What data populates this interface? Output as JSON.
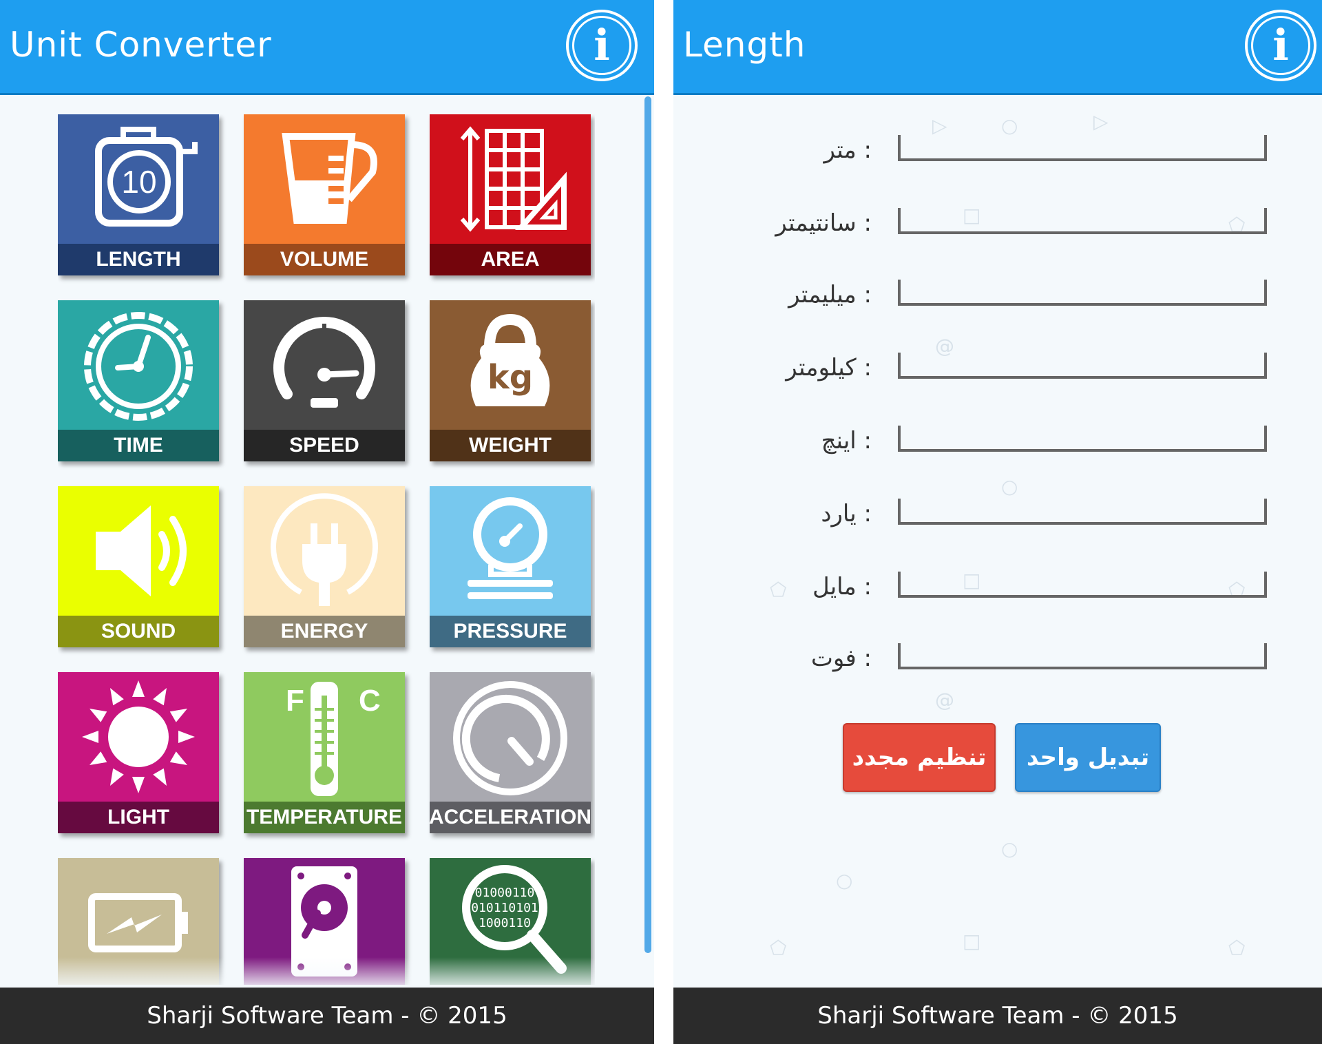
{
  "left_screen": {
    "title": "Unit Converter",
    "info_glyph": "i",
    "tiles": [
      {
        "label": "LENGTH",
        "bg": "#3c5fa3",
        "band": "#1f3a6b",
        "icon": "tape-measure-icon",
        "number": "10"
      },
      {
        "label": "VOLUME",
        "bg": "#f47a2e",
        "band": "#9b4a1c",
        "icon": "measuring-cup-icon"
      },
      {
        "label": "AREA",
        "bg": "#d0101b",
        "band": "#74050c",
        "icon": "grid-ruler-icon"
      },
      {
        "label": "TIME",
        "bg": "#2aa7a4",
        "band": "#17605e",
        "icon": "clock-icon"
      },
      {
        "label": "SPEED",
        "bg": "#474747",
        "band": "#262626",
        "icon": "speedometer-icon"
      },
      {
        "label": "WEIGHT",
        "bg": "#8a5b33",
        "band": "#503218",
        "icon": "kettlebell-icon",
        "weight_text": "kg"
      },
      {
        "label": "SOUND",
        "bg": "#eaff00",
        "band": "#8a9412",
        "icon": "speaker-icon"
      },
      {
        "label": "ENERGY",
        "bg": "#fde8c0",
        "band": "#8f8670",
        "icon": "plug-icon"
      },
      {
        "label": "PRESSURE",
        "bg": "#77c8ee",
        "band": "#3f6b84",
        "icon": "pressure-gauge-icon"
      },
      {
        "label": "LIGHT",
        "bg": "#c8157f",
        "band": "#660a40",
        "icon": "sun-icon"
      },
      {
        "label": "TEMPERATURE",
        "bg": "#8fca5f",
        "band": "#4c7a30",
        "icon": "thermometer-icon",
        "f": "F",
        "c": "C"
      },
      {
        "label": "ACCELERATION",
        "bg": "#a9a9b0",
        "band": "#5d5d62",
        "icon": "accelerometer-icon"
      },
      {
        "label": "",
        "bg": "#c7bd97",
        "band": "#c7bd97",
        "icon": "battery-icon"
      },
      {
        "label": "",
        "bg": "#7e1a80",
        "band": "#7e1a80",
        "icon": "hard-drive-icon"
      },
      {
        "label": "",
        "bg": "#2e6d3f",
        "band": "#2e6d3f",
        "icon": "binary-search-icon",
        "bits": [
          "01000110",
          "010110101",
          "1000110"
        ]
      }
    ],
    "footer": "Sharji Software Team - © 2015"
  },
  "right_screen": {
    "title": "Length",
    "info_glyph": "i",
    "fields": [
      {
        "label": ": متر",
        "value": ""
      },
      {
        "label": ": سانتیمتر",
        "value": ""
      },
      {
        "label": ": میلیمتر",
        "value": ""
      },
      {
        "label": ": کیلومتر",
        "value": ""
      },
      {
        "label": ": اینچ",
        "value": ""
      },
      {
        "label": ": یارد",
        "value": ""
      },
      {
        "label": ": مایل",
        "value": ""
      },
      {
        "label": ": فوت",
        "value": ""
      }
    ],
    "reset_button": "تنظیم مجدد",
    "convert_button": "تبدیل واحد",
    "footer": "Sharji Software Team - © 2015"
  }
}
